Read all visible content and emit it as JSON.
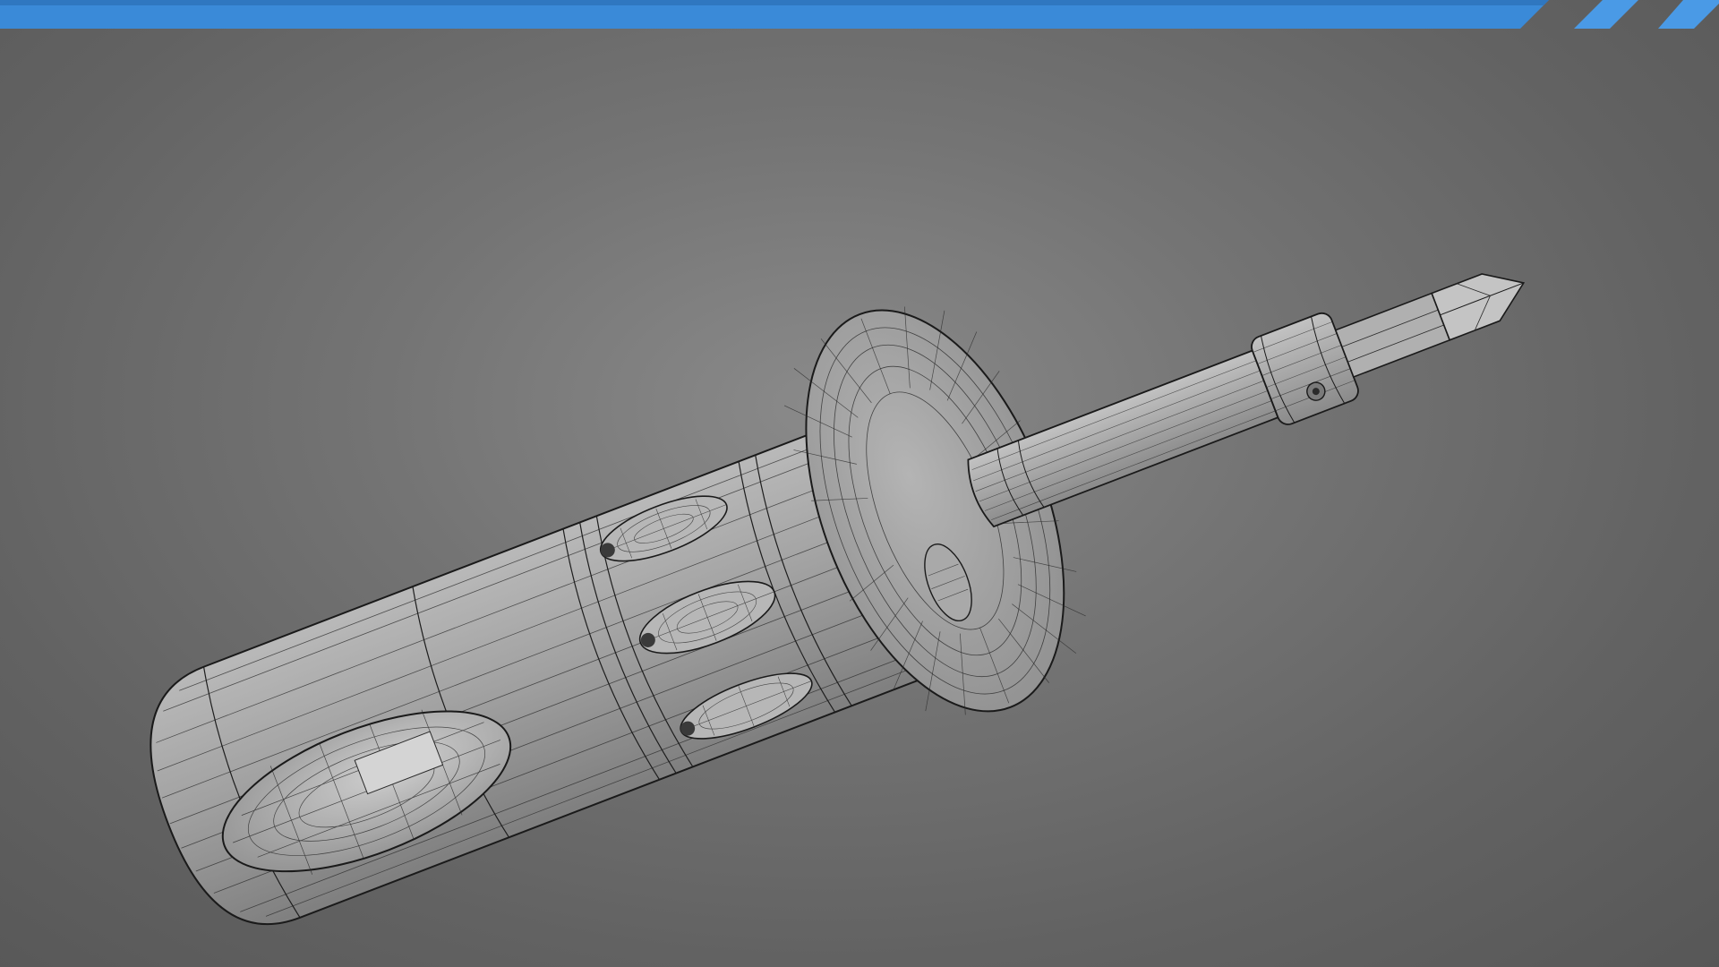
{
  "header": {
    "accent_color": "#3a8ad8",
    "stripe_color": "#4a9ae6"
  },
  "viewport": {
    "background_center": "#8a8a8a",
    "background_edge": "#575757",
    "mesh_fill": "#a3a3a3",
    "mesh_shadow": "#7c7c7c",
    "wire_color": "#1a1a1a",
    "subject": "screwdriver-wireframe-model"
  }
}
